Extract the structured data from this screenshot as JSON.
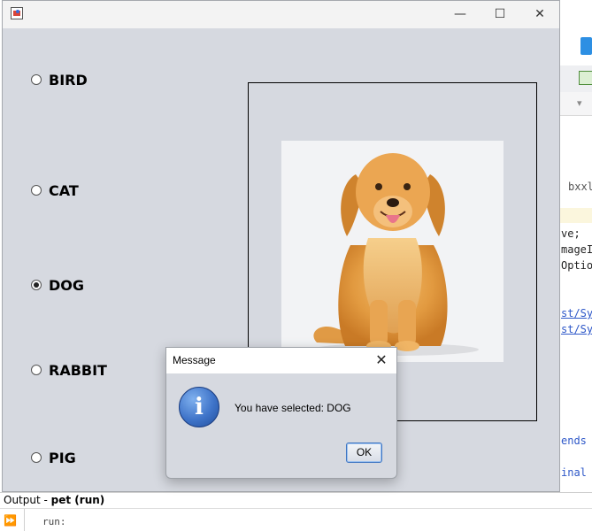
{
  "app": {
    "radio_options": [
      {
        "label": "BIRD",
        "checked": false
      },
      {
        "label": "CAT",
        "checked": false
      },
      {
        "label": "DOG",
        "checked": true
      },
      {
        "label": "RABBIT",
        "checked": false
      },
      {
        "label": "PIG",
        "checked": false
      }
    ]
  },
  "window_controls": {
    "minimize": "—",
    "maximize": "☐",
    "close": "✕"
  },
  "dialog": {
    "title": "Message",
    "close": "✕",
    "icon": "i",
    "message": "You have selected: DOG",
    "ok_label": "OK"
  },
  "ide": {
    "code_fragments": [
      "bxxl",
      "ve;",
      "mageI",
      "Optio",
      "st/Sy",
      "st/Sy",
      "ends",
      "inal"
    ],
    "output_title_prefix": "Output - ",
    "output_title_project": "pet (run)",
    "output_text": "run:"
  },
  "colors": {
    "window_bg": "#d6d9e0",
    "accent": "#3e75c2",
    "info_icon": "#3f74c9"
  }
}
